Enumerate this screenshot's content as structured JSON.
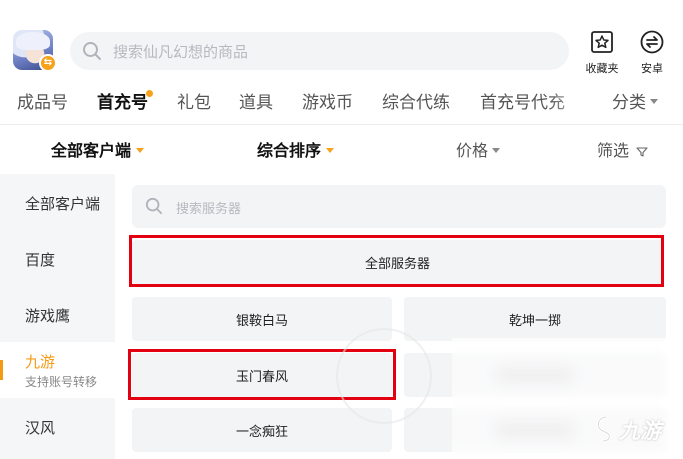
{
  "header": {
    "search_placeholder": "搜索仙凡幻想的商品",
    "favorites_label": "收藏夹",
    "android_label": "安卓",
    "avatar_badge_icon": "swap-icon"
  },
  "tabs": [
    {
      "label": "成品号",
      "active": false
    },
    {
      "label": "首充号",
      "active": true
    },
    {
      "label": "礼包",
      "active": false
    },
    {
      "label": "道具",
      "active": false
    },
    {
      "label": "游戏币",
      "active": false
    },
    {
      "label": "综合代练",
      "active": false
    },
    {
      "label": "首充号代充",
      "active": false
    }
  ],
  "category_label": "分类",
  "filters": {
    "client": "全部客户端",
    "sort": "综合排序",
    "price": "价格",
    "screen": "筛选"
  },
  "sidebar": [
    {
      "label": "全部客户端",
      "sub": "",
      "active": false
    },
    {
      "label": "百度",
      "sub": "",
      "active": false
    },
    {
      "label": "游戏鹰",
      "sub": "",
      "active": false
    },
    {
      "label": "九游",
      "sub": "支持账号转移",
      "active": true
    },
    {
      "label": "汉风",
      "sub": "",
      "active": false
    }
  ],
  "server_search_placeholder": "搜索服务器",
  "servers": {
    "all": "全部服务器",
    "items": [
      "银鞍白马",
      "乾坤一掷",
      "玉门春风",
      "",
      "一念痴狂",
      ""
    ]
  },
  "watermark": "九游",
  "colors": {
    "accent": "#f49b14",
    "highlight_box": "#e30010",
    "chip_bg": "#f3f4f6",
    "sidebar_bg": "#f5f6f8"
  }
}
